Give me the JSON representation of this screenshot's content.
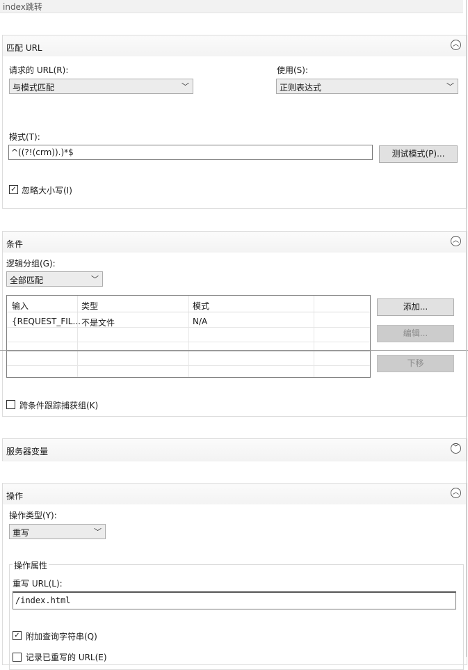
{
  "rule_name": "index跳转",
  "match_url": {
    "title": "匹配 URL",
    "requested_url_label": "请求的 URL(R):",
    "requested_url_value": "与模式匹配",
    "using_label": "使用(S):",
    "using_value": "正则表达式",
    "pattern_label": "模式(T):",
    "pattern_value": "^((?!(crm)).)*$",
    "test_pattern_button": "测试模式(P)...",
    "ignore_case_label": "忽略大小写(I)",
    "ignore_case_checked": true
  },
  "conditions": {
    "title": "条件",
    "logical_grouping_label": "逻辑分组(G):",
    "logical_grouping_value": "全部匹配",
    "columns": [
      "输入",
      "类型",
      "模式"
    ],
    "rows": [
      {
        "input": "{REQUEST_FIL...",
        "type": "不是文件",
        "pattern": "N/A"
      }
    ],
    "add_button": "添加...",
    "edit_button": "编辑...",
    "move_down_button": "下移",
    "track_groups_label": "跨条件跟踪捕获组(K)",
    "track_groups_checked": false
  },
  "server_variables": {
    "title": "服务器变量"
  },
  "action": {
    "title": "操作",
    "action_type_label": "操作类型(Y):",
    "action_type_value": "重写",
    "properties_legend": "操作属性",
    "rewrite_url_label": "重写 URL(L):",
    "rewrite_url_value": "/index.html",
    "append_query_label": "附加查询字符串(Q)",
    "append_query_checked": true,
    "log_rewritten_label": "记录已重写的 URL(E)",
    "log_rewritten_checked": false
  }
}
